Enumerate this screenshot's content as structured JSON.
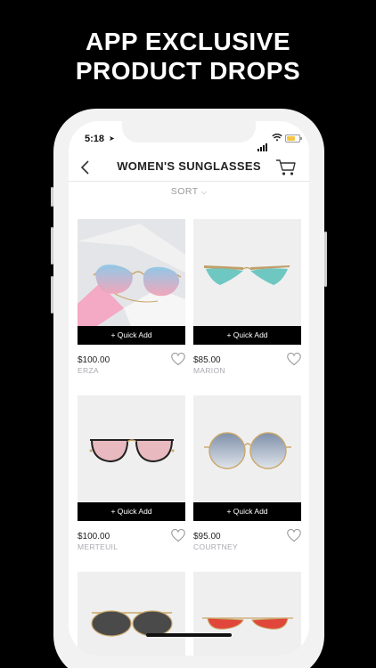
{
  "promo": {
    "line1": "APP EXCLUSIVE",
    "line2": "PRODUCT DROPS"
  },
  "status": {
    "time": "5:18"
  },
  "nav": {
    "title": "WOMEN'S SUNGLASSES"
  },
  "sort": {
    "label": "SORT"
  },
  "quick_add_label": "+ Quick Add",
  "products": [
    {
      "price": "$100.00",
      "name": "ERZA"
    },
    {
      "price": "$85.00",
      "name": "MARION"
    },
    {
      "price": "$100.00",
      "name": "MERTEUIL"
    },
    {
      "price": "$95.00",
      "name": "COURTNEY"
    }
  ],
  "colors": {
    "background": "#000000",
    "accent": "#000000",
    "muted_text": "#a9aab0",
    "battery": "#f5c542"
  }
}
